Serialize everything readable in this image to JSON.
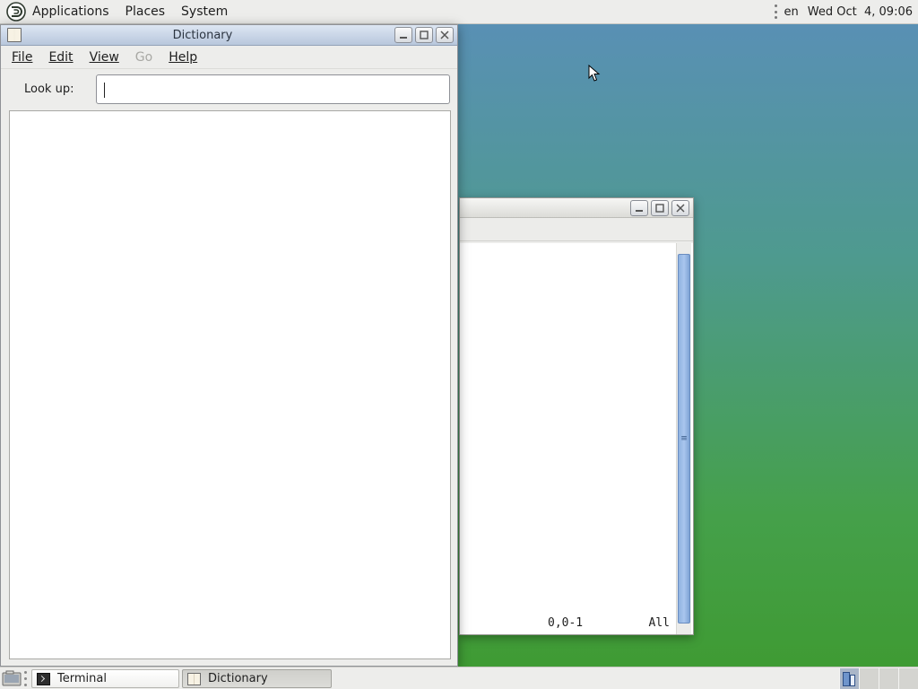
{
  "top_panel": {
    "menus": [
      {
        "label": "Applications"
      },
      {
        "label": "Places"
      },
      {
        "label": "System"
      }
    ],
    "keyboard_layout": "en",
    "clock": "Wed Oct  4, 09:06"
  },
  "dictionary": {
    "title": "Dictionary",
    "menu": [
      {
        "label": "File",
        "disabled": false
      },
      {
        "label": "Edit",
        "disabled": false
      },
      {
        "label": "View",
        "disabled": false
      },
      {
        "label": "Go",
        "disabled": true
      },
      {
        "label": "Help",
        "disabled": false
      }
    ],
    "lookup_label": "Look up:",
    "lookup_value": ""
  },
  "terminal": {
    "cursor_position": "0,0-1",
    "scroll_scope": "All"
  },
  "taskbar": {
    "tasks": [
      {
        "label": "Terminal",
        "active": false
      },
      {
        "label": "Dictionary",
        "active": true
      }
    ]
  },
  "colors": {
    "desktop_top": "#5a8fb8",
    "desktop_bottom": "#3e9a30",
    "panel": "#ededeb",
    "titlebar_active": "#b8c7dc"
  }
}
